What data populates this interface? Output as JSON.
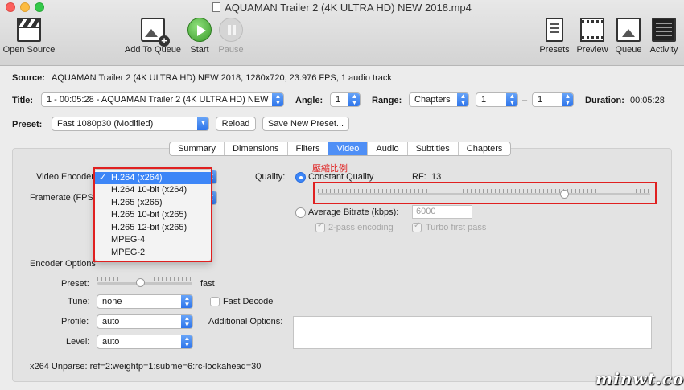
{
  "window": {
    "title": "AQUAMAN Trailer 2 (4K ULTRA HD) NEW 2018.mp4"
  },
  "toolbar": {
    "open_source": "Open Source",
    "add_to_queue": "Add To Queue",
    "start": "Start",
    "pause": "Pause",
    "presets": "Presets",
    "preview": "Preview",
    "queue": "Queue",
    "activity": "Activity"
  },
  "source": {
    "label": "Source:",
    "value": "AQUAMAN Trailer 2 (4K ULTRA HD) NEW 2018, 1280x720, 23.976 FPS, 1 audio track"
  },
  "title_row": {
    "title_label": "Title:",
    "title_value": "1 - 00:05:28 - AQUAMAN Trailer 2 (4K ULTRA HD) NEW",
    "angle_label": "Angle:",
    "angle_value": "1",
    "range_label": "Range:",
    "range_value": "Chapters",
    "range_start": "1",
    "range_dash": "–",
    "range_end": "1",
    "duration_label": "Duration:",
    "duration_value": "00:05:28"
  },
  "preset_row": {
    "label": "Preset:",
    "value": "Fast 1080p30 (Modified)",
    "reload": "Reload",
    "save_new": "Save New Preset..."
  },
  "tabs": [
    "Summary",
    "Dimensions",
    "Filters",
    "Video",
    "Audio",
    "Subtitles",
    "Chapters"
  ],
  "active_tab": "Video",
  "video": {
    "encoder_label": "Video Encoder:",
    "framerate_label": "Framerate (FPS):",
    "quality_label": "Quality:",
    "constant_quality": "Constant Quality",
    "rf_label": "RF:",
    "rf_value": "13",
    "quality_slider_fraction": 0.74,
    "avg_bitrate": "Average Bitrate (kbps):",
    "bitrate_value": "6000",
    "two_pass": "2-pass encoding",
    "turbo": "Turbo first pass"
  },
  "encoder_menu": {
    "items": [
      "H.264 (x264)",
      "H.264 10-bit (x264)",
      "H.265 (x265)",
      "H.265 10-bit (x265)",
      "H.265 12-bit (x265)",
      "MPEG-4",
      "MPEG-2"
    ],
    "selected": "H.264 (x264)",
    "check": "✓"
  },
  "annotation": {
    "text": "壓縮比例"
  },
  "encoder_options": {
    "heading": "Encoder Options",
    "preset_label": "Preset:",
    "preset_value": "fast",
    "preset_slider_fraction": 0.45,
    "tune_label": "Tune:",
    "tune_value": "none",
    "fast_decode": "Fast Decode",
    "profile_label": "Profile:",
    "profile_value": "auto",
    "additional_label": "Additional Options:",
    "level_label": "Level:",
    "level_value": "auto",
    "unparse": "x264 Unparse: ref=2:weightp=1:subme=6:rc-lookahead=30"
  },
  "watermark": {
    "text": "minwt.com"
  },
  "colors": {
    "accent": "#3d86f7",
    "annotation_red": "#e02020"
  }
}
